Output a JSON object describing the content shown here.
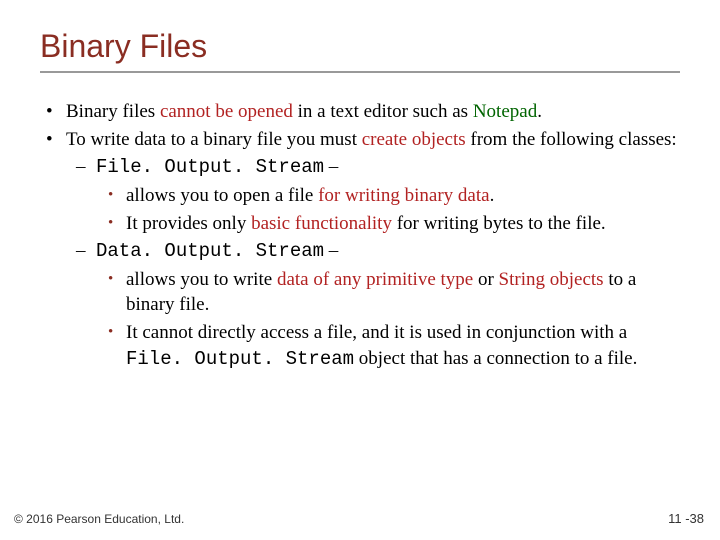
{
  "title": "Binary Files",
  "bullets": {
    "b1_pre": "Binary files ",
    "b1_red": "cannot be opened",
    "b1_mid": " in a text editor such as ",
    "b1_green": "Notepad",
    "b1_end": ".",
    "b2_pre": "To write data to a binary file you must ",
    "b2_red": "create objects",
    "b2_end": " from the following classes:",
    "fos_code": "File. Output. Stream",
    "fos_dash": " –",
    "fos_a_pre": "allows you to open a file ",
    "fos_a_red": "for writing binary data",
    "fos_a_end": ".",
    "fos_b_pre": "It provides only ",
    "fos_b_red": "basic functionality",
    "fos_b_end": " for writing bytes to the file.",
    "dos_code": "Data. Output. Stream",
    "dos_dash": " –",
    "dos_a_pre": "allows you to write ",
    "dos_a_red1": "data of any primitive type",
    "dos_a_mid": " or ",
    "dos_a_red2": "String objects",
    "dos_a_end": " to a binary file.",
    "dos_b_pre": "It cannot directly access a file, and it is used in conjunction with a ",
    "dos_b_code": "File. Output. Stream",
    "dos_b_end": " object that has a connection to a file."
  },
  "footer": {
    "left": "© 2016 Pearson Education, Ltd.",
    "right": "11 -38"
  }
}
